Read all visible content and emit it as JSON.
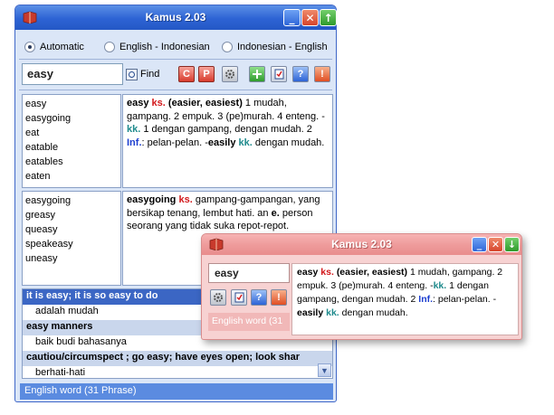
{
  "main_window": {
    "title": "Kamus 2.03",
    "buttons": {
      "minimize": "_",
      "close": "✕",
      "up": "↑"
    },
    "modes": [
      {
        "label": "Automatic",
        "selected": true
      },
      {
        "label": "English - Indonesian",
        "selected": false
      },
      {
        "label": "Indonesian - English",
        "selected": false
      }
    ],
    "search": {
      "value": "easy",
      "find_label": "Find"
    },
    "toolbar": {
      "c_label": "C",
      "p_label": "P",
      "help_label": "?",
      "warn_label": "!"
    },
    "word_list_1": [
      "easy",
      "easygoing",
      "eat",
      "eatable",
      "eatables",
      "eaten"
    ],
    "definition_1": {
      "word": "easy",
      "pos": "ks.",
      "forms": "(easier, easiest)",
      "s1": "1 mudah, gampang. 2 empuk. 3 (pe)murah. 4 enteng. -",
      "kk1": "kk.",
      "s2": "1 dengan gampang, dengan mudah. 2",
      "inf": "Inf.",
      "s3": ": pelan-pelan. -",
      "adv": "easily",
      "kk2": "kk.",
      "s4": "dengan mudah."
    },
    "word_list_2": [
      "easygoing",
      "greasy",
      "queasy",
      "speakeasy",
      "uneasy"
    ],
    "definition_2": {
      "word": "easygoing",
      "pos": "ks.",
      "s1": "gampang-gampangan, yang bersikap tenang, lembut hati. an",
      "e": "e.",
      "s2": "person seorang yang tidak suka repot-repot."
    },
    "phrases": [
      {
        "english": "it is easy; it is so easy to do",
        "indonesian": "adalah mudah",
        "selected": true
      },
      {
        "english": "easy manners",
        "indonesian": "baik budi bahasanya",
        "selected": false
      },
      {
        "english": "cautiou/circumspect ; go easy; have eyes open; look shar",
        "indonesian": "berhati-hati",
        "selected": false
      }
    ],
    "scroll_icon": "▼",
    "status": "English word (31 Phrase)"
  },
  "mini_window": {
    "title": "Kamus 2.03",
    "buttons": {
      "minimize": "_",
      "close": "✕",
      "down": "↓"
    },
    "search_value": "easy",
    "toolbar": {
      "help_label": "?",
      "warn_label": "!"
    },
    "status": "English word (31",
    "definition": {
      "word": "easy",
      "pos": "ks.",
      "forms": "(easier, easiest)",
      "s1": "1 mudah, gampang. 2 empuk. 3 (pe)murah. 4 enteng. -",
      "kk1": "kk.",
      "s2": "1 dengan gampang, dengan mudah. 2",
      "inf": "Inf.",
      "s3": ": pelan-pelan. -",
      "adv": "easily",
      "kk2": "kk.",
      "s4": "dengan mudah."
    }
  },
  "colors": {
    "titlebar_blue": "#2d63d4",
    "titlebar_pink": "#ee9a9a",
    "pos_red": "#d2171a",
    "kk_teal": "#1e8a8c",
    "inf_blue": "#1d3fd0",
    "selected_row": "#3b66c4"
  },
  "icons": [
    "app-book-icon",
    "magnifier-icon",
    "gear-icon",
    "add-icon",
    "checklist-icon",
    "help-icon",
    "warning-icon"
  ]
}
